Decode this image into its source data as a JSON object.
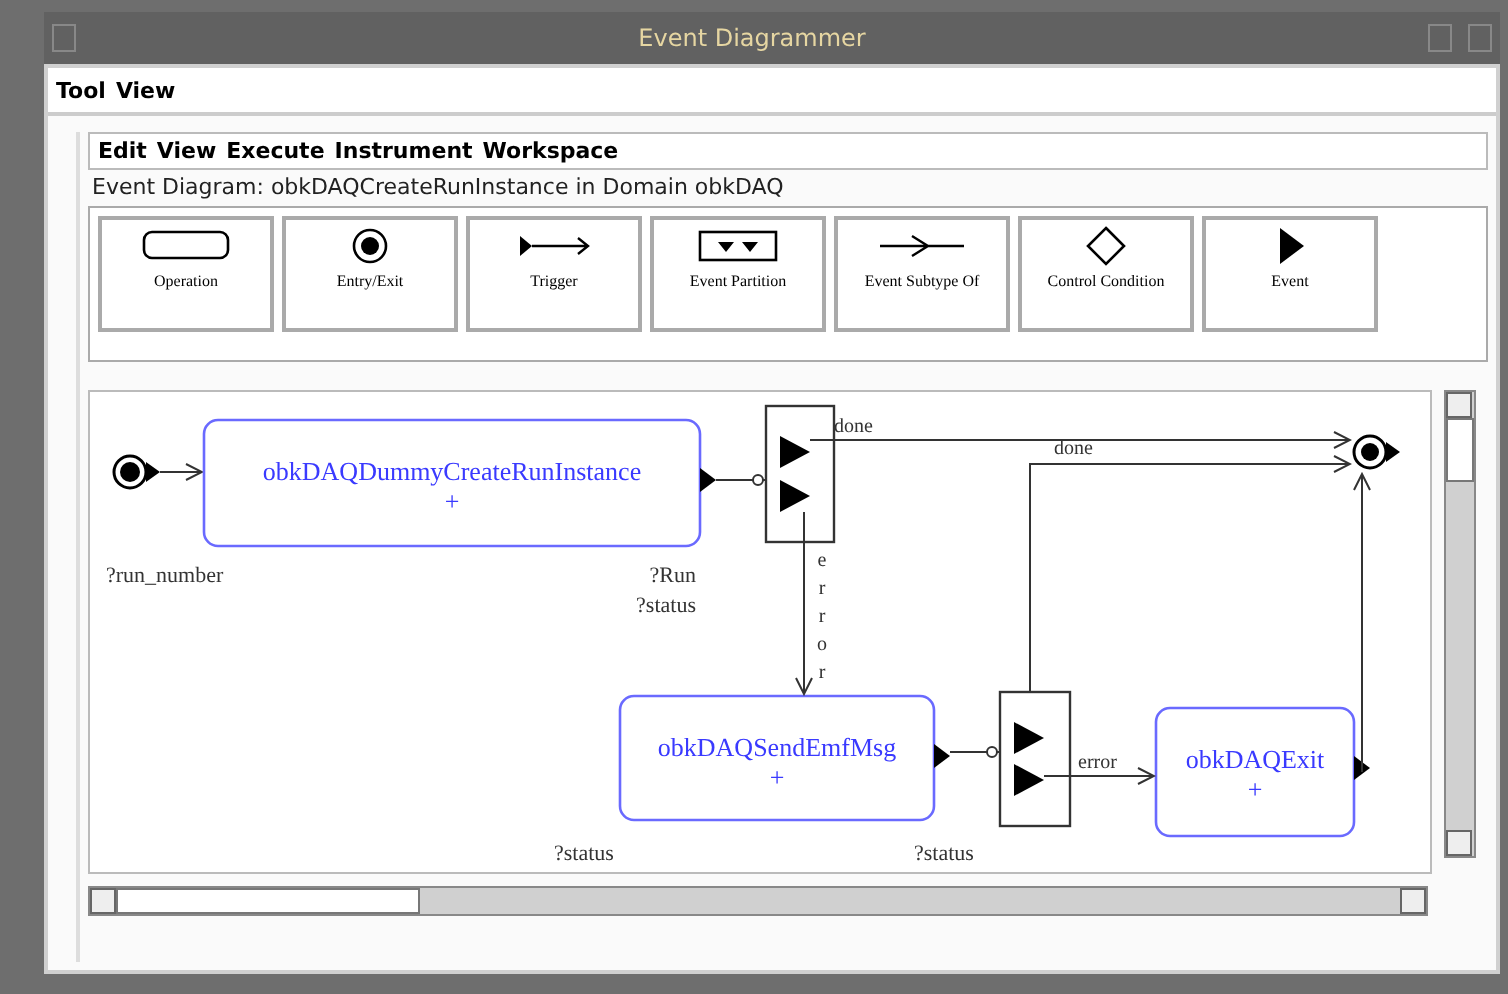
{
  "window": {
    "title": "Event Diagrammer"
  },
  "tool_menu": [
    "Tool",
    "View"
  ],
  "menu": [
    "Edit",
    "View",
    "Execute",
    "Instrument",
    "Workspace"
  ],
  "diagram_title": "Event Diagram: obkDAQCreateRunInstance in Domain obkDAQ",
  "palette": [
    {
      "kind": "operation",
      "label": "Operation"
    },
    {
      "kind": "entry_exit",
      "label": "Entry/Exit"
    },
    {
      "kind": "trigger",
      "label": "Trigger"
    },
    {
      "kind": "partition",
      "label": "Event Partition"
    },
    {
      "kind": "subtype",
      "label": "Event Subtype Of"
    },
    {
      "kind": "condition",
      "label": "Control Condition"
    },
    {
      "kind": "event",
      "label": "Event"
    }
  ],
  "diagram": {
    "operations": [
      {
        "name": "obkDAQDummyCreateRunInstance",
        "marker": "+"
      },
      {
        "name": "obkDAQSendEmfMsg",
        "marker": "+"
      },
      {
        "name": "obkDAQExit",
        "marker": "+"
      }
    ],
    "flow_labels": [
      {
        "kind": "horizontal",
        "text": "done"
      },
      {
        "kind": "horizontal",
        "text": "done"
      },
      {
        "kind": "vertical",
        "text": "error"
      },
      {
        "kind": "horizontal",
        "text": "error"
      }
    ],
    "parameters": [
      "?run_number",
      "?Run",
      "?status",
      "?status",
      "?status"
    ]
  }
}
